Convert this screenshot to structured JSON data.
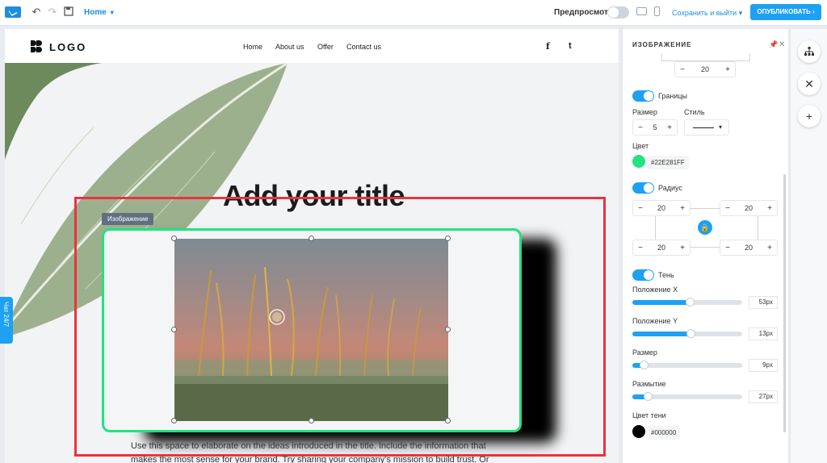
{
  "topbar": {
    "page_selector": "Home",
    "preview_label": "Предпросмотр",
    "save_exit_label": "Сохранить и выйти",
    "publish_label": "ОПУБЛИКОВАТЬ"
  },
  "site": {
    "logo_text": "LOGO",
    "nav": [
      "Home",
      "About us",
      "Offer",
      "Contact us"
    ],
    "social": [
      "f",
      "t"
    ],
    "hero_title": "Add your title",
    "image_tag": "Изображение",
    "body_text": "Use this space to elaborate on the ideas introduced in the title. Include the information that makes the most sense for your brand. Try sharing your company's mission to build trust. Or"
  },
  "chat_tab": "Чат 24/7",
  "panel": {
    "title": "ИЗОБРАЖЕНИЕ",
    "top_stepper_value": "20",
    "borders_label": "Границы",
    "size_label": "Размер",
    "style_label": "Стиль",
    "border_size": "5",
    "color_label": "Цвет",
    "border_color_hex": "#22E281FF",
    "border_color": "#22E281",
    "radius_label": "Радиус",
    "radius_values": [
      "20",
      "20",
      "20",
      "20"
    ],
    "shadow_label": "Тень",
    "sliders": [
      {
        "label": "Положение X",
        "value": "53px",
        "fraction": 0.52
      },
      {
        "label": "Положение Y",
        "value": "13px",
        "fraction": 0.53
      },
      {
        "label": "Размер",
        "value": "9px",
        "fraction": 0.1
      },
      {
        "label": "Размытие",
        "value": "27px",
        "fraction": 0.14
      }
    ],
    "shadow_color_label": "Цвет тени",
    "shadow_color_hex": "#000000",
    "shadow_color": "#000000"
  }
}
